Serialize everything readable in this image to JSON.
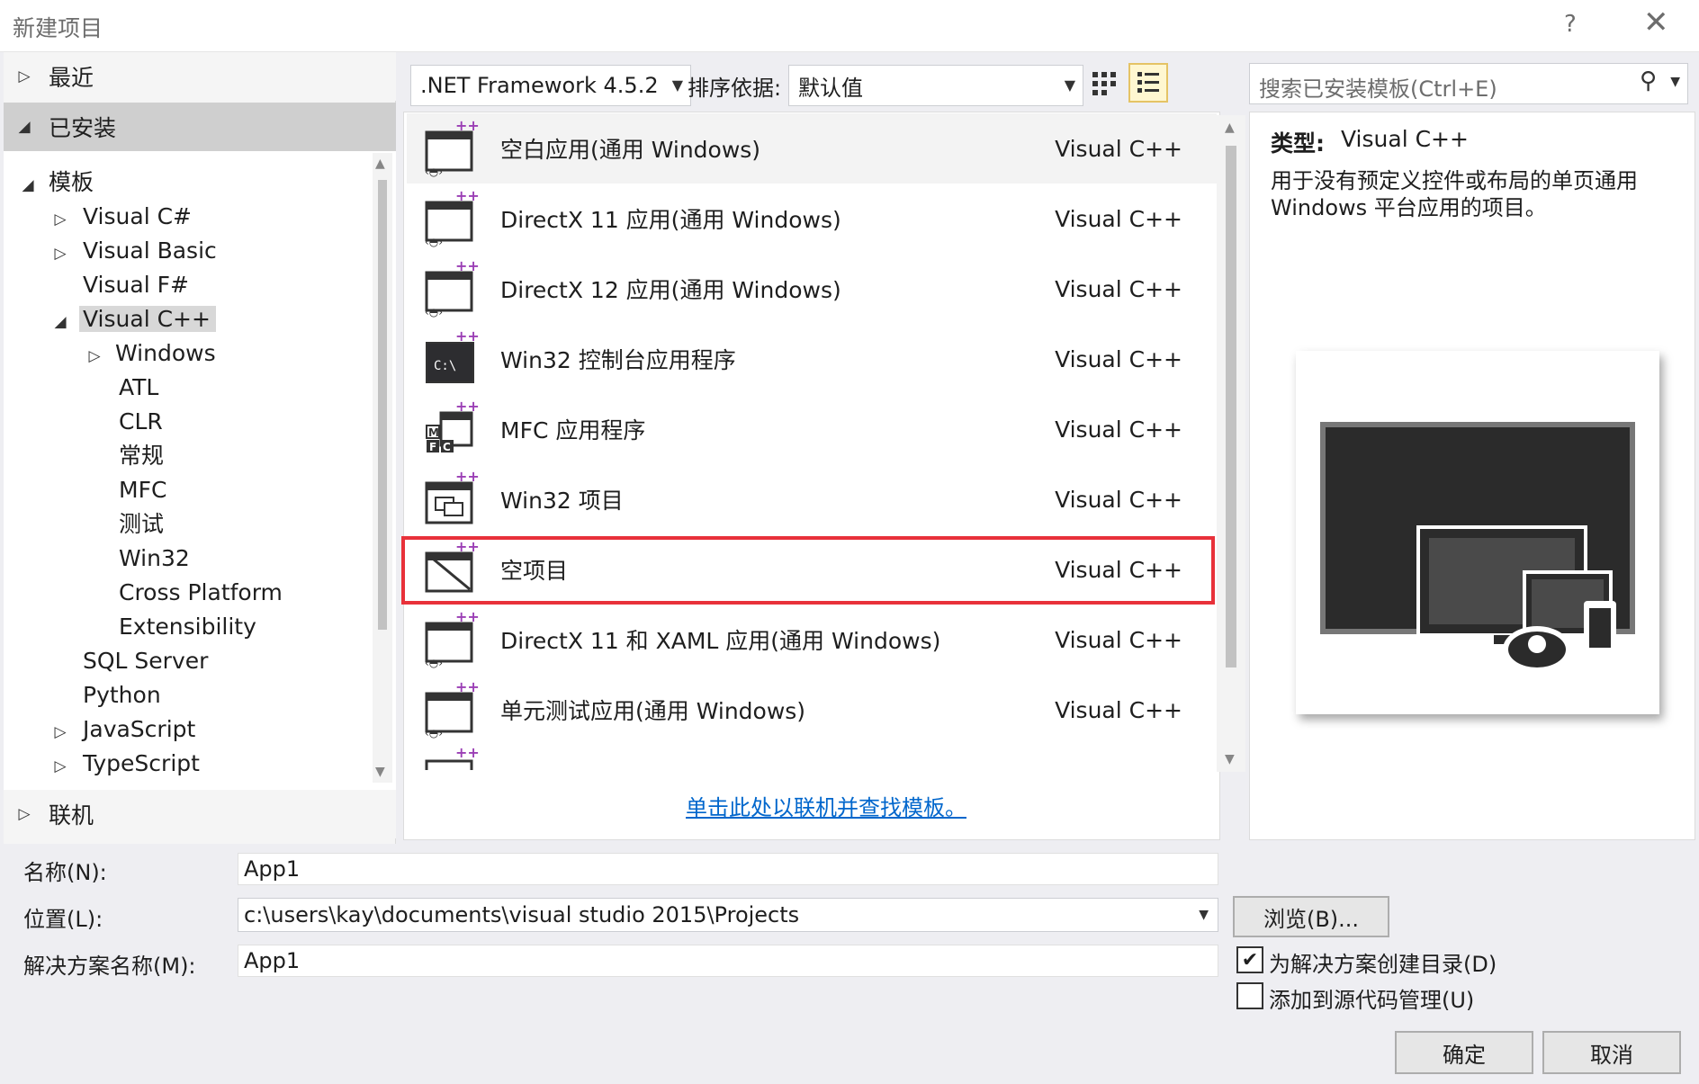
{
  "window": {
    "title": "新建项目",
    "help": "?",
    "close": "✕"
  },
  "nav": {
    "recent": "最近",
    "installed": "已安装",
    "online": "联机",
    "tree": {
      "templates": "模板",
      "csharp": "Visual C#",
      "vb": "Visual Basic",
      "fsharp": "Visual F#",
      "vcpp": "Visual C++",
      "windows": "Windows",
      "atl": "ATL",
      "clr": "CLR",
      "general": "常规",
      "mfc": "MFC",
      "test": "测试",
      "win32": "Win32",
      "cross": "Cross Platform",
      "ext": "Extensibility",
      "sql": "SQL Server",
      "python": "Python",
      "js": "JavaScript",
      "ts": "TypeScript"
    }
  },
  "toolbar": {
    "framework": ".NET Framework 4.5.2",
    "sort_label": "排序依据:",
    "sort_value": "默认值",
    "search_placeholder": "搜索已安装模板(Ctrl+E)"
  },
  "templates": [
    {
      "name": "空白应用(通用 Windows)",
      "lang": "Visual C++"
    },
    {
      "name": "DirectX 11 应用(通用 Windows)",
      "lang": "Visual C++"
    },
    {
      "name": "DirectX 12 应用(通用 Windows)",
      "lang": "Visual C++"
    },
    {
      "name": "Win32 控制台应用程序",
      "lang": "Visual C++"
    },
    {
      "name": "MFC 应用程序",
      "lang": "Visual C++"
    },
    {
      "name": "Win32 项目",
      "lang": "Visual C++"
    },
    {
      "name": "空项目",
      "lang": "Visual C++"
    },
    {
      "name": "DirectX 11 和 XAML 应用(通用 Windows)",
      "lang": "Visual C++"
    },
    {
      "name": "单元测试应用(通用 Windows)",
      "lang": "Visual C++"
    }
  ],
  "online_link": "单击此处以联机并查找模板。",
  "details": {
    "type_label": "类型:",
    "type_value": "Visual C++",
    "description": "用于没有预定义控件或布局的单页通用 Windows 平台应用的项目。"
  },
  "form": {
    "name_label": "名称(N):",
    "name_value": "App1",
    "location_label": "位置(L):",
    "location_value": "c:\\users\\kay\\documents\\visual studio 2015\\Projects",
    "solution_label": "解决方案名称(M):",
    "solution_value": "App1",
    "browse": "浏览(B)...",
    "create_dir": "为解决方案创建目录(D)",
    "create_dir_checked": true,
    "add_source": "添加到源代码管理(U)",
    "add_source_checked": false,
    "ok": "确定",
    "cancel": "取消"
  },
  "colors": {
    "highlight": "#e8313a",
    "link": "#0066cc",
    "accent_plus": "#9b3fb5"
  }
}
